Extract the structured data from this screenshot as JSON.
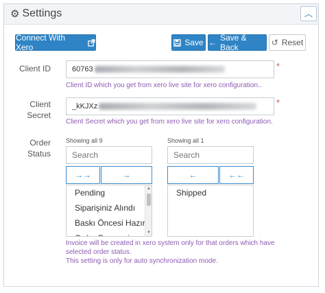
{
  "header": {
    "title": "Settings",
    "gear_icon": "⚙",
    "collapse_icon": "︿"
  },
  "toolbar": {
    "connect_label": "Connect With Xero",
    "save_label": "Save",
    "save_back_label": "Save & Back",
    "reset_label": "Reset"
  },
  "client_id": {
    "label": "Client ID",
    "value_prefix": "60763",
    "help": "Client ID which you get from xero live site for xero configuration.."
  },
  "client_secret": {
    "label_line1": "Client",
    "label_line2": "Secret",
    "value_prefix": "_kKJXz",
    "help": "Client Secret which you get from xero live site for xero configuration."
  },
  "order_status": {
    "label_line1": "Order",
    "label_line2": "Status",
    "available": {
      "showing": "Showing all 9",
      "search_placeholder": "Search",
      "move_all_label": "→→",
      "move_selected_label": "→",
      "options": [
        "Pending",
        "Siparişiniz Alındı",
        "Baskı Öncesi Hazırlık",
        "Order Processing"
      ]
    },
    "selected": {
      "showing": "Showing all 1",
      "search_placeholder": "Search",
      "remove_selected_label": "←",
      "remove_all_label": "←←",
      "options": [
        "Shipped"
      ]
    },
    "help_line1": "Invoice will be created in xero system only for that orders which have",
    "help_line2": "selected order status.",
    "help_line3": "This setting is only for auto synchronization mode."
  },
  "colors": {
    "primary": "#2f84c5",
    "help_text": "#8e5bb3",
    "required": "#d9534f"
  }
}
